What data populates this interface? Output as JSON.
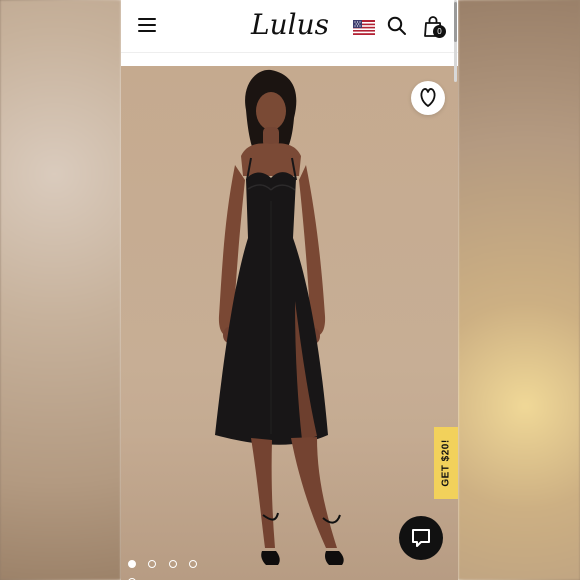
{
  "app": {
    "logo_text": "Lulus",
    "cart_count": "0",
    "flag": "us-flag-icon",
    "promo_label": "GET $20!",
    "gallery": {
      "dot_count": 5,
      "active_index": 0
    }
  },
  "icons": {
    "menu": "hamburger-menu-icon",
    "search": "search-icon",
    "bag": "shopping-bag-icon",
    "wishlist": "heart-icon",
    "chat": "chat-icon"
  },
  "colors": {
    "brand": "#111111",
    "promo": "#f2d15b",
    "background": "#ffffff"
  }
}
